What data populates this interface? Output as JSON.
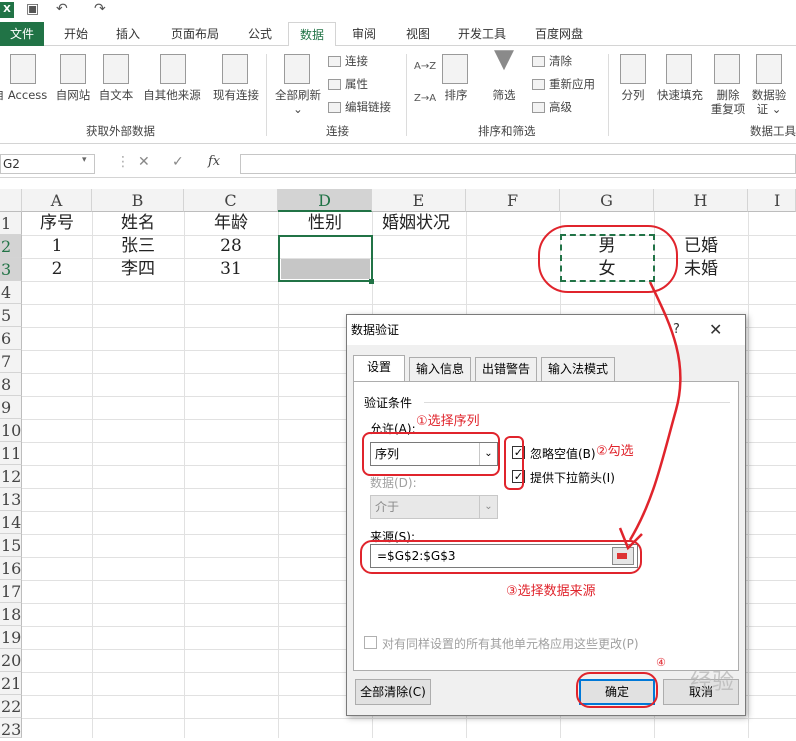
{
  "app": {
    "icon": "excel-icon",
    "qat_undo": "↶",
    "qat_redo": "↷"
  },
  "tabs": [
    "文件",
    "开始",
    "插入",
    "页面布局",
    "公式",
    "数据",
    "审阅",
    "视图",
    "开发工具",
    "百度网盘"
  ],
  "active_tab": "数据",
  "ribbon": {
    "get_external": {
      "buttons": [
        "自 Access",
        "自网站",
        "自文本",
        "自其他来源",
        "现有连接"
      ],
      "label": "获取外部数据"
    },
    "connections": {
      "refresh_all_line1": "全部刷新",
      "refresh_all_line2": "⌄",
      "small": [
        "连接",
        "属性",
        "编辑链接"
      ],
      "label": "连接"
    },
    "sort_filter": {
      "sort_az": "A→Z",
      "sort_za": "Z→A",
      "sort": "排序",
      "filter": "筛选",
      "small": [
        "清除",
        "重新应用",
        "高级"
      ],
      "label": "排序和筛选"
    },
    "data_tools": {
      "buttons": [
        "分列",
        "快速填充"
      ],
      "remove_dup_line1": "删除",
      "remove_dup_line2": "重复项",
      "validation_line1": "数据验",
      "validation_line2": "证 ⌄",
      "label": "数据工具"
    }
  },
  "formula_bar": {
    "name_box": "G2",
    "cancel": "✕",
    "enter": "✓",
    "fx": "fx",
    "value": ""
  },
  "columns": [
    "A",
    "B",
    "C",
    "D",
    "E",
    "F",
    "G",
    "H",
    "I"
  ],
  "rows": [
    "1",
    "2",
    "3",
    "4",
    "5",
    "6",
    "7",
    "8",
    "9",
    "10",
    "11",
    "12",
    "13",
    "14",
    "15",
    "16",
    "17",
    "18",
    "19",
    "20",
    "21",
    "22",
    "23"
  ],
  "cells": {
    "A1": "序号",
    "B1": "姓名",
    "C1": "年龄",
    "D1": "性别",
    "E1": "婚姻状况",
    "A2": "1",
    "B2": "张三",
    "C2": "28",
    "A3": "2",
    "B3": "李四",
    "C3": "31",
    "G2": "男",
    "G3": "女",
    "H2": "已婚",
    "H3": "未婚"
  },
  "dialog": {
    "title": "数据验证",
    "help": "?",
    "close": "✕",
    "tabs": [
      "设置",
      "输入信息",
      "出错警告",
      "输入法模式"
    ],
    "section": "验证条件",
    "allow_label": "允许(A):",
    "allow_value": "序列",
    "data_label": "数据(D):",
    "data_value": "介于",
    "ignore_blank": "忽略空值(B)",
    "ignore_blank_checked": true,
    "dropdown": "提供下拉箭头(I)",
    "dropdown_checked": true,
    "source_label": "来源(S):",
    "source_value": "=$G$2:$G$3",
    "apply_all": "对有同样设置的所有其他单元格应用这些更改(P)",
    "clear_all": "全部清除(C)",
    "ok": "确定",
    "cancel": "取消"
  },
  "annotations": {
    "step1": "①选择序列",
    "step2": "②勾选",
    "step3": "③选择数据来源",
    "step4": "④"
  },
  "watermark": "经验",
  "colors": {
    "excel_green": "#217346",
    "annotation_red": "#e0242c"
  }
}
